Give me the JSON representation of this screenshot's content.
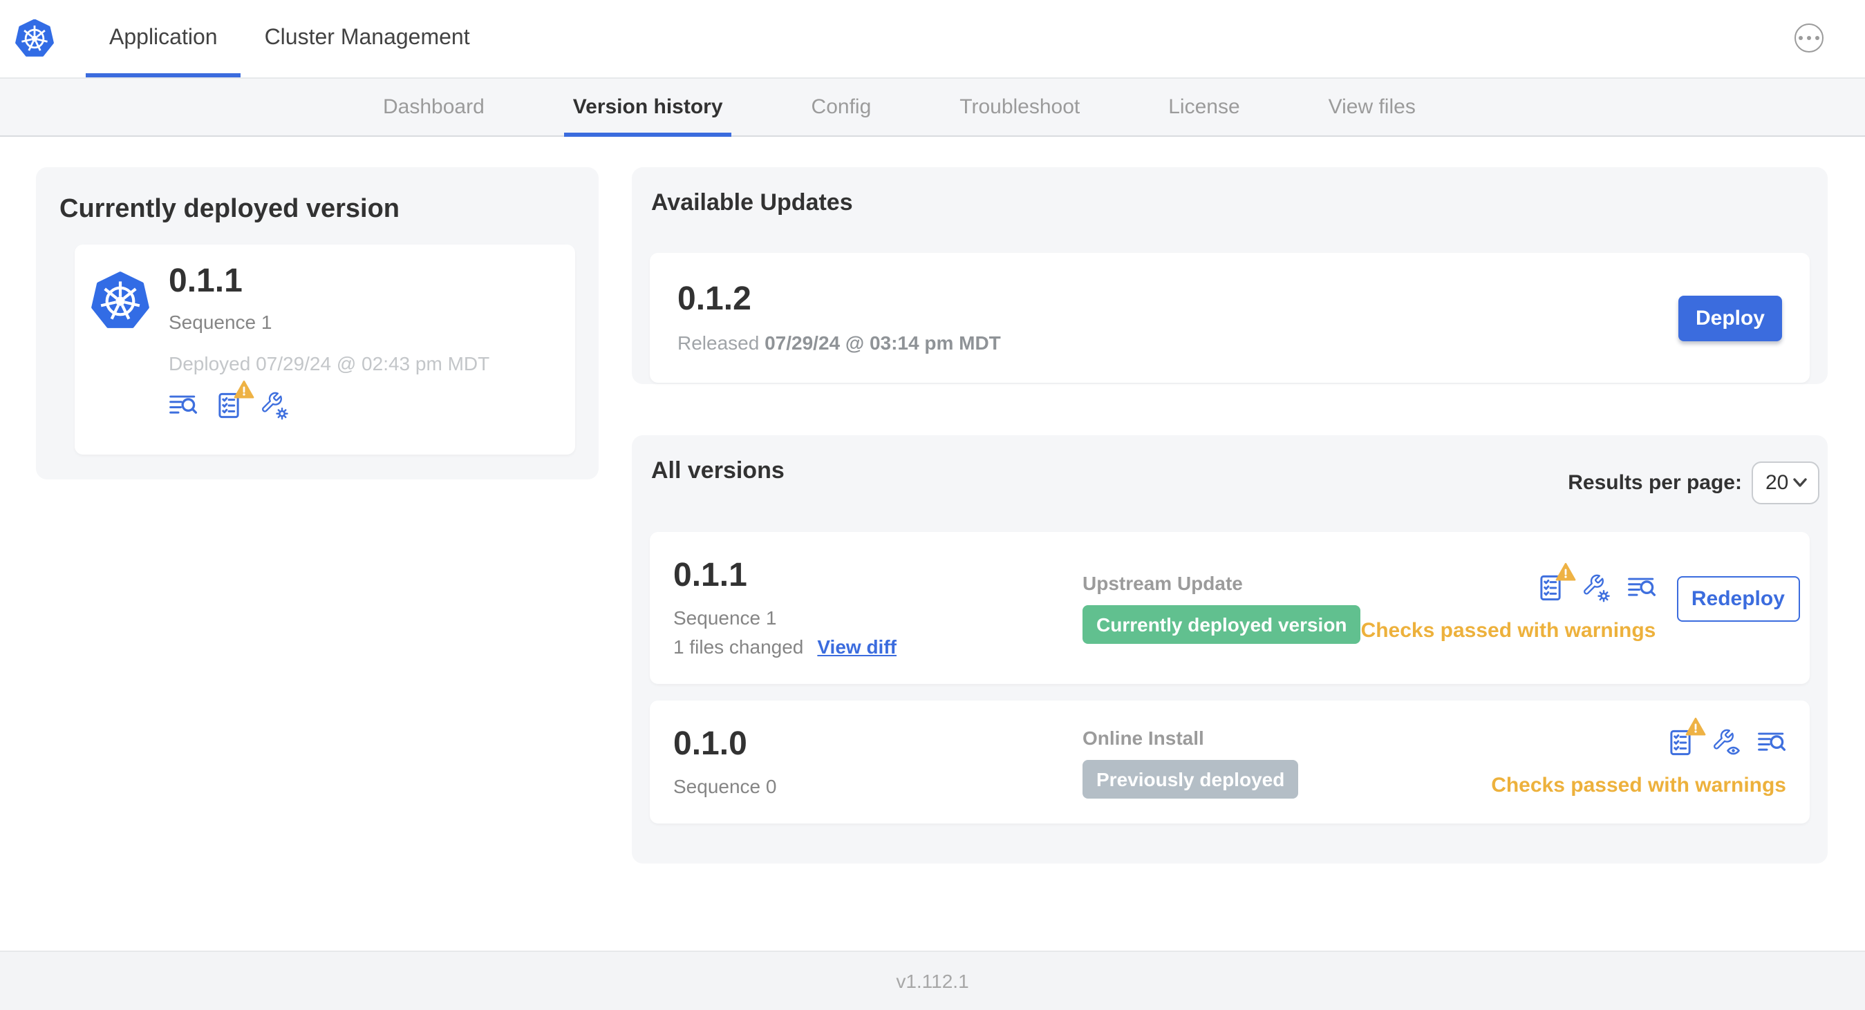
{
  "header": {
    "tabs": [
      {
        "label": "Application",
        "active": true
      },
      {
        "label": "Cluster Management",
        "active": false
      }
    ],
    "more_menu_icon": "ellipsis-icon",
    "logo_icon": "kubernetes-logo"
  },
  "subnav": {
    "tabs": [
      {
        "label": "Dashboard",
        "active": false
      },
      {
        "label": "Version history",
        "active": true
      },
      {
        "label": "Config",
        "active": false
      },
      {
        "label": "Troubleshoot",
        "active": false
      },
      {
        "label": "License",
        "active": false
      },
      {
        "label": "View files",
        "active": false
      }
    ]
  },
  "deployed_card": {
    "title": "Currently deployed version",
    "version": "0.1.1",
    "sequence": "Sequence 1",
    "deployed_at": "Deployed 07/29/24 @ 02:43 pm MDT",
    "icons": [
      "deploy-logs-icon",
      "preflight-checks-warning-icon",
      "config-icon"
    ]
  },
  "available_updates": {
    "title": "Available Updates",
    "version": "0.1.2",
    "released_label": "Released",
    "released_date": "07/29/24 @ 03:14 pm MDT",
    "deploy_label": "Deploy"
  },
  "all_versions": {
    "title": "All versions",
    "results_per_page_label": "Results per page:",
    "results_per_page_value": "20",
    "rows": [
      {
        "version": "0.1.1",
        "sequence": "Sequence 1",
        "files_changed": "1 files changed",
        "view_diff_label": "View diff",
        "source": "Upstream Update",
        "badge": "Currently deployed version",
        "badge_type": "green",
        "icons": [
          "preflight-checks-warning-icon",
          "config-icon",
          "deploy-logs-icon"
        ],
        "status": "Checks passed with warnings",
        "action_label": "Redeploy"
      },
      {
        "version": "0.1.0",
        "sequence": "Sequence 0",
        "source": "Online Install",
        "badge": "Previously deployed",
        "badge_type": "gray",
        "icons": [
          "preflight-checks-warning-icon",
          "config-view-icon",
          "deploy-logs-icon"
        ],
        "status": "Checks passed with warnings"
      }
    ]
  },
  "footer": {
    "app_version": "v1.112.1"
  },
  "colors": {
    "accent_blue": "#3b6cde",
    "kubernetes_blue": "#326ce5",
    "success_green": "#61c08f",
    "neutral_badge_gray": "#b4bec6",
    "warning_orange": "#edb13c",
    "panel_gray": "#f5f6f8"
  }
}
